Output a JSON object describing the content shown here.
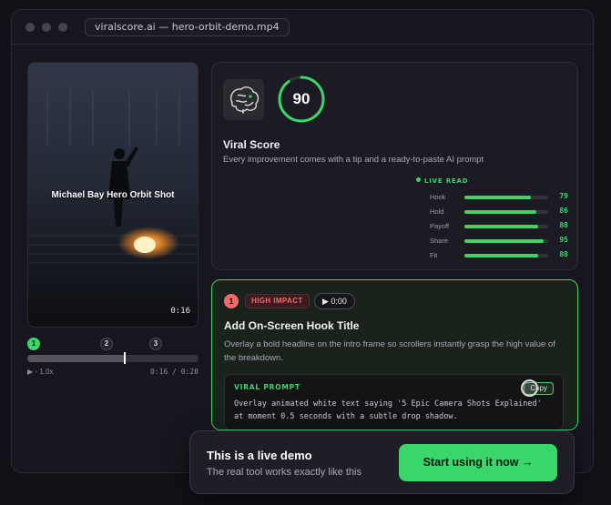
{
  "window": {
    "url": "viralscore.ai — hero-orbit-demo.mp4"
  },
  "video": {
    "caption": "Michael Bay Hero Orbit Shot",
    "timestamp": "0:16"
  },
  "timeline": {
    "markers": [
      "1",
      "2",
      "3"
    ],
    "playback_label": "▶ ◦ 1.0x",
    "time_label": "0:16 / 0:28",
    "progress": 0.57
  },
  "score": {
    "value": "90",
    "ring_fraction": 0.9,
    "title": "Viral Score",
    "subtitle": "Every improvement comes with a tip and a ready-to-paste AI prompt",
    "live_read_label": "LIVE READ",
    "accent_color": "#3ad66a",
    "metrics": [
      {
        "label": "Hook",
        "value": "79"
      },
      {
        "label": "Hold",
        "value": "86"
      },
      {
        "label": "Payoff",
        "value": "88"
      },
      {
        "label": "Share",
        "value": "95"
      },
      {
        "label": "Fit",
        "value": "88"
      }
    ]
  },
  "tip": {
    "number": "1",
    "impact": "HIGH IMPACT",
    "time": "▶ 0:00",
    "title": "Add On-Screen Hook Title",
    "description": "Overlay a bold headline on the intro frame so scrollers instantly grasp the high value of the breakdown.",
    "prompt_label": "VIRAL PROMPT",
    "copy_label": "Copy",
    "prompt_text": "Overlay animated white text saying '5 Epic Camera Shots Explained' at moment 0.5 seconds with a subtle drop shadow."
  },
  "toast": {
    "title": "This is a live demo",
    "subtitle": "The real tool works exactly like this",
    "cta_label": "Start using it now →"
  }
}
